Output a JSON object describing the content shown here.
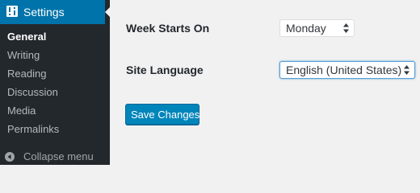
{
  "sidebar": {
    "menu_title": "Settings",
    "menu_icon": "settings-sliders-icon",
    "items": [
      {
        "label": "General",
        "current": true
      },
      {
        "label": "Writing",
        "current": false
      },
      {
        "label": "Reading",
        "current": false
      },
      {
        "label": "Discussion",
        "current": false
      },
      {
        "label": "Media",
        "current": false
      },
      {
        "label": "Permalinks",
        "current": false
      }
    ],
    "collapse_label": "Collapse menu",
    "collapse_icon": "collapse-arrow-icon"
  },
  "form": {
    "week_starts_on": {
      "label": "Week Starts On",
      "value": "Monday"
    },
    "site_language": {
      "label": "Site Language",
      "value": "English (United States)"
    },
    "save_label": "Save Changes"
  },
  "colors": {
    "sidebar_bg": "#23282d",
    "accent": "#0073aa",
    "button": "#0085ba",
    "page_bg": "#f1f1f1"
  }
}
